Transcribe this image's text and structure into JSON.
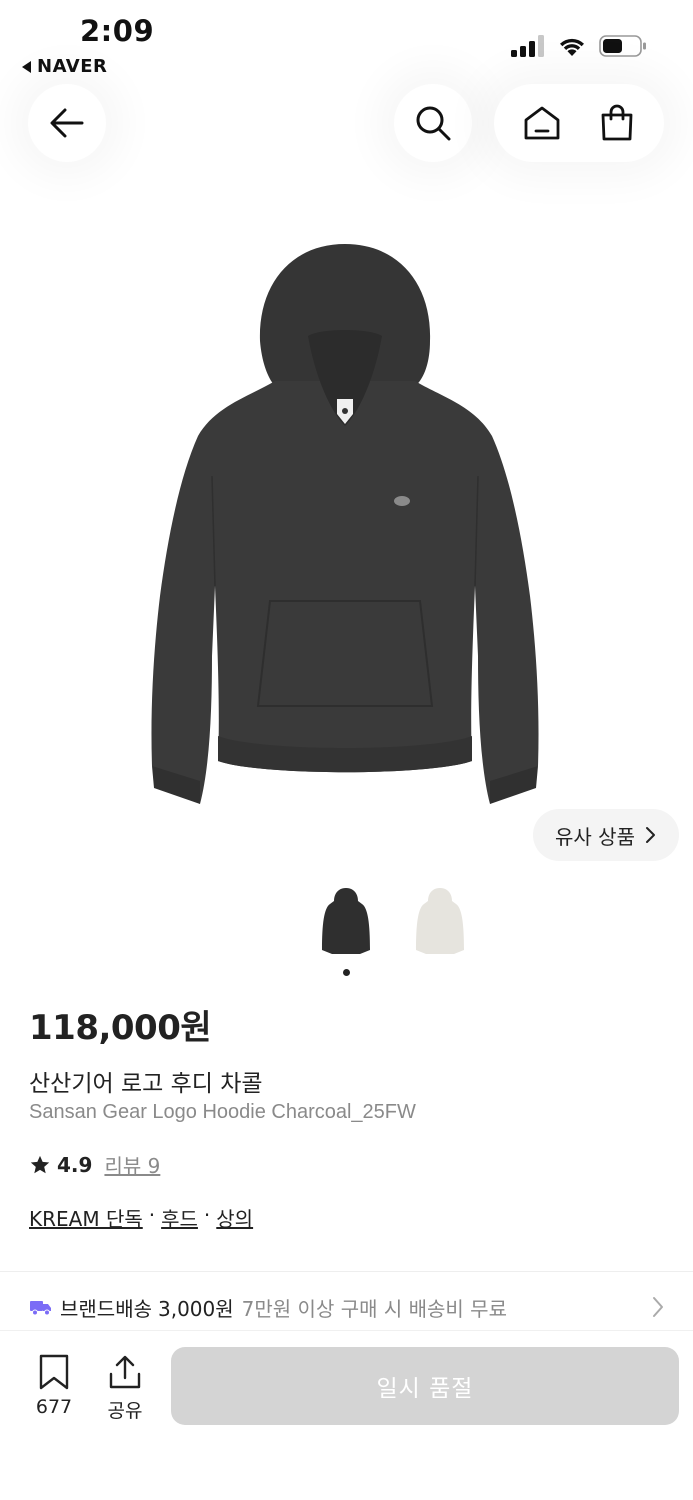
{
  "status_bar": {
    "time": "2:09",
    "back_app": "NAVER",
    "battery_level": 0.55
  },
  "nav": {
    "icons": [
      "arrow-left-icon",
      "search-icon",
      "home-icon",
      "shopping-bag-icon"
    ]
  },
  "similar": {
    "label": "유사 상품"
  },
  "gallery": {
    "thumbnails": [
      "charcoal",
      "ivory"
    ],
    "active_index": 0
  },
  "product": {
    "price": "118,000원",
    "name_ko": "산산기어 로고 후디 차콜",
    "name_en": "Sansan Gear Logo Hoodie Charcoal_25FW",
    "rating": "4.9",
    "review_label": "리뷰 9",
    "tags": [
      "KREAM 단독",
      "후드",
      "상의"
    ],
    "tag_separator": "·"
  },
  "shipping": {
    "label": "브랜드배송",
    "amount": "3,000원",
    "condition": "7만원 이상 구매 시 배송비 무료"
  },
  "bottom_bar": {
    "bookmark_count": "677",
    "share_label": "공유",
    "buy_label": "일시 품절"
  },
  "colors": {
    "accent_purple": "#7b6cf6",
    "disabled_button": "#d4d4d4",
    "hoodie": "#3a3a3a",
    "hoodie_alt": "#e6e4de"
  }
}
